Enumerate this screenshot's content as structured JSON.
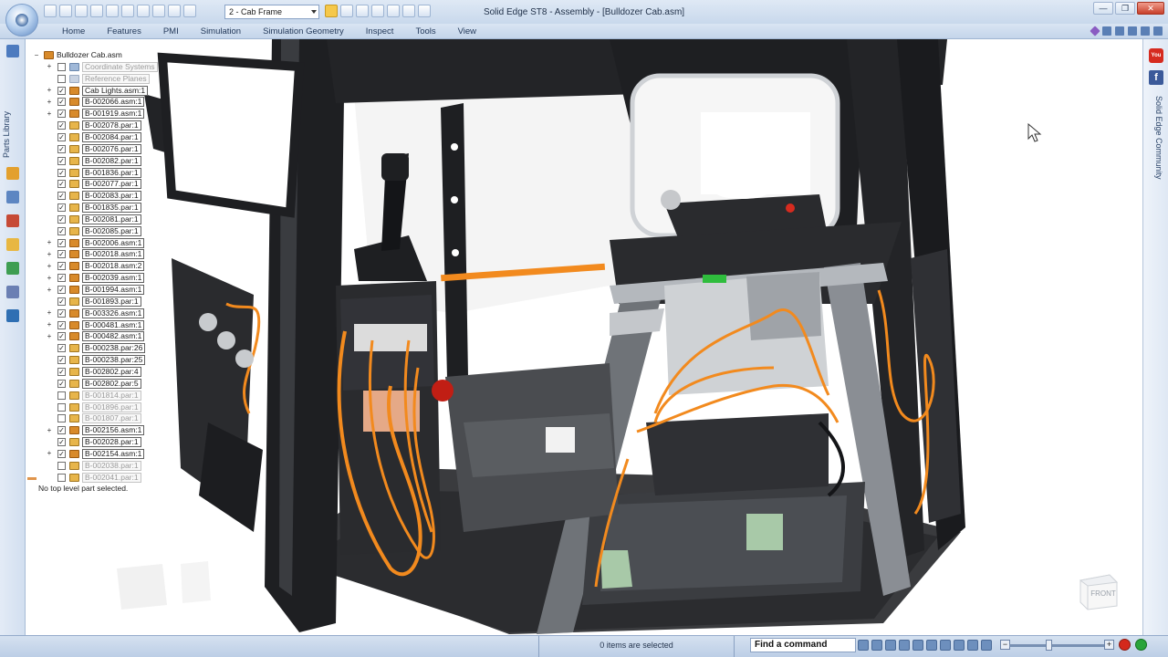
{
  "window": {
    "title": "Solid Edge ST8 - Assembly - [Bulldozer Cab.asm]",
    "environment_select": "2 - Cab Frame",
    "controls": {
      "minimize": "—",
      "restore": "❐",
      "close": "✕"
    }
  },
  "ribbon": {
    "tabs": [
      "Home",
      "Features",
      "PMI",
      "Simulation",
      "Simulation Geometry",
      "Inspect",
      "Tools",
      "View"
    ]
  },
  "leftbar": {
    "label": "Parts Library"
  },
  "rightbar": {
    "label": "Solid Edge Community",
    "youtube": "You",
    "facebook": "f"
  },
  "pathfinder": {
    "root": "Bulldozer Cab.asm",
    "items": [
      {
        "label": "Coordinate Systems",
        "kind": "cs",
        "checked": false,
        "muted": true,
        "expandable": true
      },
      {
        "label": "Reference Planes",
        "kind": "rp",
        "checked": false,
        "muted": true,
        "expandable": false
      },
      {
        "label": "Cab Lights.asm:1",
        "kind": "asm",
        "checked": true,
        "muted": false,
        "expandable": true
      },
      {
        "label": "B-002066.asm:1",
        "kind": "asm",
        "checked": true,
        "muted": false,
        "expandable": true
      },
      {
        "label": "B-001919.asm:1",
        "kind": "asm",
        "checked": true,
        "muted": false,
        "expandable": true
      },
      {
        "label": "B-002078.par:1",
        "kind": "par",
        "checked": true,
        "muted": false,
        "expandable": false
      },
      {
        "label": "B-002084.par:1",
        "kind": "par",
        "checked": true,
        "muted": false,
        "expandable": false
      },
      {
        "label": "B-002076.par:1",
        "kind": "par",
        "checked": true,
        "muted": false,
        "expandable": false
      },
      {
        "label": "B-002082.par:1",
        "kind": "par",
        "checked": true,
        "muted": false,
        "expandable": false
      },
      {
        "label": "B-001836.par:1",
        "kind": "par",
        "checked": true,
        "muted": false,
        "expandable": false
      },
      {
        "label": "B-002077.par:1",
        "kind": "par",
        "checked": true,
        "muted": false,
        "expandable": false
      },
      {
        "label": "B-002083.par:1",
        "kind": "par",
        "checked": true,
        "muted": false,
        "expandable": false
      },
      {
        "label": "B-001835.par:1",
        "kind": "par",
        "checked": true,
        "muted": false,
        "expandable": false
      },
      {
        "label": "B-002081.par:1",
        "kind": "par",
        "checked": true,
        "muted": false,
        "expandable": false
      },
      {
        "label": "B-002085.par:1",
        "kind": "par",
        "checked": true,
        "muted": false,
        "expandable": false
      },
      {
        "label": "B-002006.asm:1",
        "kind": "asm",
        "checked": true,
        "muted": false,
        "expandable": true
      },
      {
        "label": "B-002018.asm:1",
        "kind": "asm",
        "checked": true,
        "muted": false,
        "expandable": true
      },
      {
        "label": "B-002018.asm:2",
        "kind": "asm",
        "checked": true,
        "muted": false,
        "expandable": true
      },
      {
        "label": "B-002039.asm:1",
        "kind": "asm",
        "checked": true,
        "muted": false,
        "expandable": true
      },
      {
        "label": "B-001994.asm:1",
        "kind": "asm",
        "checked": true,
        "muted": false,
        "expandable": true
      },
      {
        "label": "B-001893.par:1",
        "kind": "par",
        "checked": true,
        "muted": false,
        "expandable": false
      },
      {
        "label": "B-003326.asm:1",
        "kind": "asm",
        "checked": true,
        "muted": false,
        "expandable": true
      },
      {
        "label": "B-000481.asm:1",
        "kind": "asm",
        "checked": true,
        "muted": false,
        "expandable": true
      },
      {
        "label": "B-000482.asm:1",
        "kind": "asm",
        "checked": true,
        "muted": false,
        "expandable": true
      },
      {
        "label": "B-000238.par:26",
        "kind": "par",
        "checked": true,
        "muted": false,
        "expandable": false
      },
      {
        "label": "B-000238.par:25",
        "kind": "par",
        "checked": true,
        "muted": false,
        "expandable": false
      },
      {
        "label": "B-002802.par:4",
        "kind": "par",
        "checked": true,
        "muted": false,
        "expandable": false
      },
      {
        "label": "B-002802.par:5",
        "kind": "par",
        "checked": true,
        "muted": false,
        "expandable": false
      },
      {
        "label": "B-001814.par:1",
        "kind": "par",
        "checked": false,
        "muted": true,
        "expandable": false
      },
      {
        "label": "B-001896.par:1",
        "kind": "par",
        "checked": false,
        "muted": true,
        "expandable": false
      },
      {
        "label": "B-001807.par:1",
        "kind": "par",
        "checked": false,
        "muted": true,
        "expandable": false
      },
      {
        "label": "B-002156.asm:1",
        "kind": "asm",
        "checked": true,
        "muted": false,
        "expandable": true
      },
      {
        "label": "B-002028.par:1",
        "kind": "par",
        "checked": true,
        "muted": false,
        "expandable": false
      },
      {
        "label": "B-002154.asm:1",
        "kind": "asm",
        "checked": true,
        "muted": false,
        "expandable": true
      },
      {
        "label": "B-002038.par:1",
        "kind": "par",
        "checked": false,
        "muted": true,
        "expandable": false
      },
      {
        "label": "B-002041.par:1",
        "kind": "par",
        "checked": false,
        "muted": true,
        "expandable": false
      }
    ],
    "status": "No top level part selected."
  },
  "viewcube": {
    "face_label": "FRONT"
  },
  "statusbar": {
    "selection": "0 items are selected",
    "find_command": "Find a command"
  },
  "colors": {
    "frame": "#1e1f22",
    "wire": "#f28a1e",
    "accent_ribbon": "#c8d8ec"
  }
}
